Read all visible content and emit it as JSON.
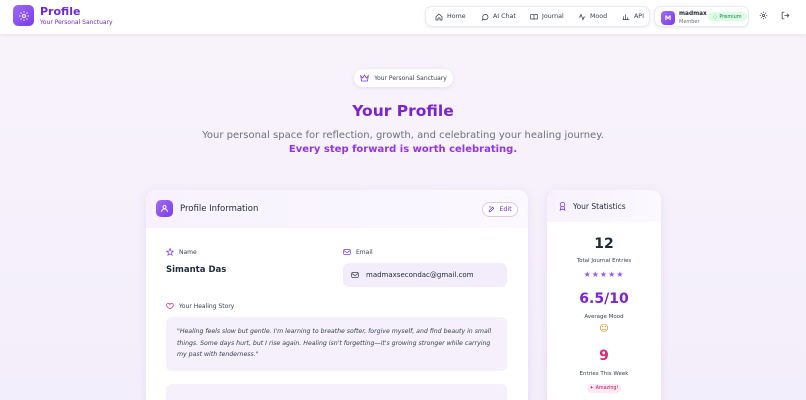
{
  "header": {
    "title": "Profile",
    "subtitle": "Your Personal Sanctuary",
    "nav": [
      {
        "label": "Home",
        "icon": "home-icon"
      },
      {
        "label": "AI Chat",
        "icon": "chat-icon"
      },
      {
        "label": "Journal",
        "icon": "book-icon"
      },
      {
        "label": "Mood",
        "icon": "activity-icon"
      },
      {
        "label": "API",
        "icon": "bar-chart-icon"
      }
    ],
    "user": {
      "initial": "M",
      "name": "madmax",
      "role": "Member",
      "badge": "Premium"
    }
  },
  "hero": {
    "pill": "Your Personal Sanctuary",
    "title": "Your Profile",
    "lead": "Your personal space for reflection, growth, and celebrating your healing journey.",
    "highlight": "Every step forward is worth celebrating."
  },
  "profile": {
    "title": "Profile Information",
    "edit_label": "Edit",
    "name_label": "Name",
    "name": "Simanta Das",
    "email_label": "Email",
    "email": "madmaxsecondac@gmail.com",
    "story_label": "Your Healing Story",
    "story": "\"Healing feels slow but gentle. I'm learning to breathe softer, forgive myself, and find beauty in small things. Some days hurt, but I rise again. Healing isn't forgetting—it's growing stronger while carrying my past with tenderness.\""
  },
  "stats": {
    "title": "Your Statistics",
    "items": [
      {
        "value": "12",
        "label": "Total Journal Entries"
      },
      {
        "value": "6.5/10",
        "label": "Average Mood"
      },
      {
        "value": "9",
        "label": "Entries This Week"
      }
    ],
    "stars": "★★★★★",
    "mood_emoji": "☺",
    "week_badge": "Amazing!"
  },
  "colors": {
    "accent": "#7c3aed",
    "title": "#7e22ce",
    "pink": "#db2777"
  }
}
